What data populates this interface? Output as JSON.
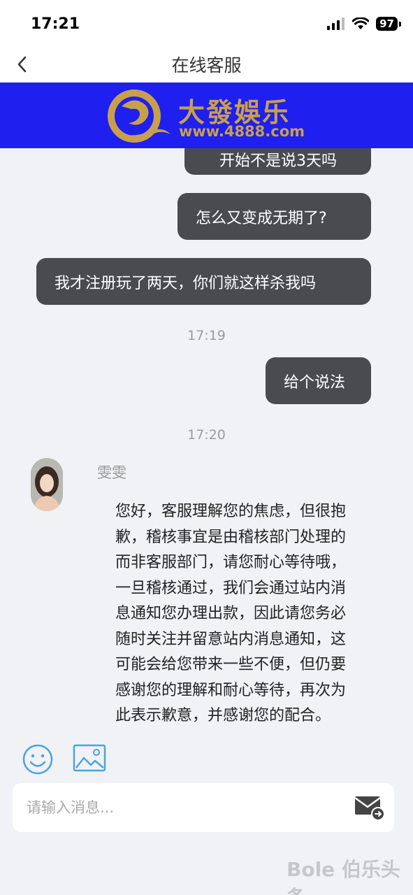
{
  "status_bar": {
    "time": "17:21",
    "battery": "97"
  },
  "nav": {
    "title": "在线客服"
  },
  "banner": {
    "brand_name": "大發娛乐",
    "brand_url": "www.4888.com"
  },
  "messages": {
    "partial_top": "开始不是说3天吗",
    "msg_1": "怎么又变成无期了?",
    "msg_2": "我才注册玩了两天，你们就这样杀我吗",
    "time_1": "17:19",
    "msg_3": "给个说法",
    "time_2": "17:20",
    "agent_name": "雯雯",
    "agent_reply": "您好，客服理解您的焦虑，但很抱歉，稽核事宜是由稽核部门处理的而非客服部门，请您耐心等待哦，一旦稽核通过，我们会通过站内消息通知您办理出款，因此请您务必随时关注并留意站内消息通知，这可能会给您带来一些不便，但仍要感谢您的理解和耐心等待，再次为此表示歉意，并感谢您的配合。"
  },
  "input": {
    "placeholder": "请输入消息..."
  },
  "watermark": {
    "text": "Bole 伯乐头条"
  }
}
